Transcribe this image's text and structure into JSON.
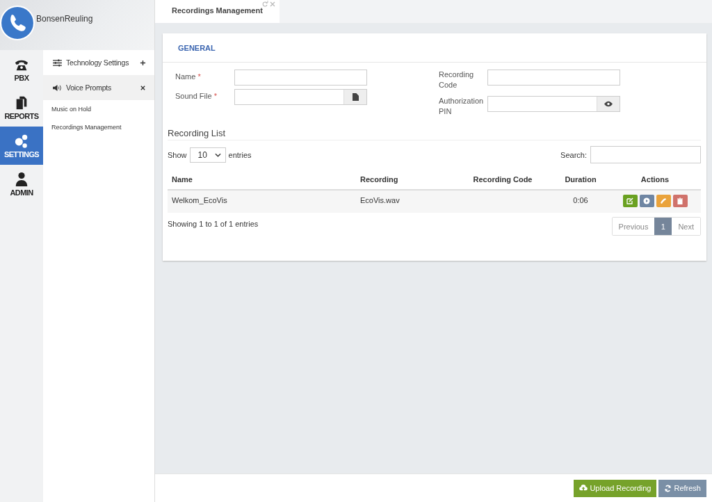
{
  "account": {
    "name": "BonsenReuling"
  },
  "nav": [
    {
      "label": "PBX",
      "selected": false
    },
    {
      "label": "REPORTS",
      "selected": false
    },
    {
      "label": "SETTINGS",
      "selected": true
    },
    {
      "label": "ADMIN",
      "selected": false
    }
  ],
  "submenu": [
    {
      "label": "Technology Settings",
      "expanded": false
    },
    {
      "label": "Voice Prompts",
      "expanded": true,
      "children": [
        {
          "label": "Music on Hold"
        },
        {
          "label": "Recordings Management"
        }
      ]
    }
  ],
  "tab": {
    "title": "Recordings Management"
  },
  "section": {
    "title": "GENERAL"
  },
  "fields_left": [
    {
      "label": "Name",
      "mark": "*",
      "kind": "text"
    },
    {
      "label": "Sound File",
      "mark": "*",
      "kind": "file"
    }
  ],
  "fields_right": [
    {
      "label": "Recording Code",
      "kind": "text"
    },
    {
      "label": "Authorization PIN",
      "kind": "secret"
    }
  ],
  "list": {
    "title": "Recording List",
    "show": "Show",
    "page_size": "10",
    "entries": "entries",
    "search_label": "Search:",
    "columns": [
      "Name",
      "Recording",
      "Recording Code",
      "Duration",
      "Actions"
    ],
    "rows": [
      {
        "cells": [
          "Welkom_EcoVis",
          "EcoVis.wav",
          "",
          "0:06"
        ],
        "actions": [
          {
            "color": "#6aa121"
          },
          {
            "color": "#6f86a3"
          },
          {
            "color": "#eaa33c"
          },
          {
            "color": "#d0726b"
          }
        ]
      }
    ],
    "info": "Showing 1 to 1 of 1 entries",
    "pages": [
      {
        "label": "Previous",
        "selected": false
      },
      {
        "label": "1",
        "selected": true
      },
      {
        "label": "Next",
        "selected": false
      }
    ]
  },
  "footer_buttons": [
    {
      "label": "Upload Recording",
      "color": "#76a22a"
    },
    {
      "label": "Refresh",
      "color": "#7a8fa6"
    }
  ]
}
